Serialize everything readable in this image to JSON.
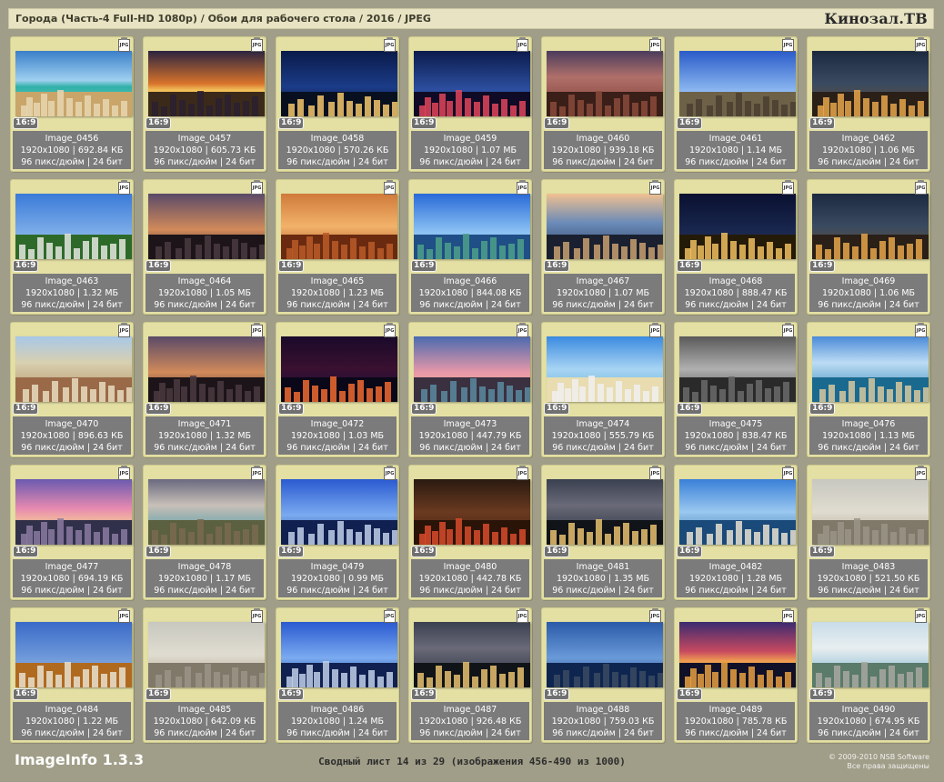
{
  "header": {
    "title": "Города (Часть-4 Full-HD 1080p) / Обои для рабочего стола / 2016 / JPEG",
    "brand": "Кинозал.ТВ"
  },
  "card_common": {
    "ratio": "16:9",
    "format_badge": "JPG",
    "dpi_line": "96 пикс/дюйм | 24 бит",
    "resolution": "1920x1080"
  },
  "cards": [
    {
      "name": "Image_0456",
      "size": "692.84 КБ",
      "theme": "resort"
    },
    {
      "name": "Image_0457",
      "size": "605.73 КБ",
      "theme": "sunset"
    },
    {
      "name": "Image_0458",
      "size": "570.26 КБ",
      "theme": "bridge-night"
    },
    {
      "name": "Image_0459",
      "size": "1.07 МБ",
      "theme": "bridge-lights"
    },
    {
      "name": "Image_0460",
      "size": "939.18 КБ",
      "theme": "cliff"
    },
    {
      "name": "Image_0461",
      "size": "1.14 МБ",
      "theme": "eiffel"
    },
    {
      "name": "Image_0462",
      "size": "1.06 МБ",
      "theme": "street-night"
    },
    {
      "name": "Image_0463",
      "size": "1.32 МБ",
      "theme": "palace"
    },
    {
      "name": "Image_0464",
      "size": "1.05 МБ",
      "theme": "dusk-city"
    },
    {
      "name": "Image_0465",
      "size": "1.23 МБ",
      "theme": "arch-bridge"
    },
    {
      "name": "Image_0466",
      "size": "844.08 КБ",
      "theme": "liberty"
    },
    {
      "name": "Image_0467",
      "size": "1.07 МБ",
      "theme": "manhattan"
    },
    {
      "name": "Image_0468",
      "size": "888.47 КБ",
      "theme": "vatican"
    },
    {
      "name": "Image_0469",
      "size": "1.06 МБ",
      "theme": "street-night"
    },
    {
      "name": "Image_0470",
      "size": "896.63 КБ",
      "theme": "aerial"
    },
    {
      "name": "Image_0471",
      "size": "1.32 МБ",
      "theme": "dusk-city"
    },
    {
      "name": "Image_0472",
      "size": "1.03 МБ",
      "theme": "night-lights"
    },
    {
      "name": "Image_0473",
      "size": "447.79 КБ",
      "theme": "pink-towers"
    },
    {
      "name": "Image_0474",
      "size": "555.79 КБ",
      "theme": "beach"
    },
    {
      "name": "Image_0475",
      "size": "838.47 КБ",
      "theme": "london-bw"
    },
    {
      "name": "Image_0476",
      "size": "1.13 МБ",
      "theme": "harbor"
    },
    {
      "name": "Image_0477",
      "size": "694.19 КБ",
      "theme": "pink-sky"
    },
    {
      "name": "Image_0478",
      "size": "1.17 МБ",
      "theme": "coast"
    },
    {
      "name": "Image_0479",
      "size": "0.99 МБ",
      "theme": "blue-city"
    },
    {
      "name": "Image_0480",
      "size": "442.78 КБ",
      "theme": "square"
    },
    {
      "name": "Image_0481",
      "size": "1.35 МБ",
      "theme": "night-skyline"
    },
    {
      "name": "Image_0482",
      "size": "1.28 МБ",
      "theme": "marina"
    },
    {
      "name": "Image_0483",
      "size": "521.50 КБ",
      "theme": "haze"
    },
    {
      "name": "Image_0484",
      "size": "1.22 МБ",
      "theme": "castle"
    },
    {
      "name": "Image_0485",
      "size": "642.09 КБ",
      "theme": "haze"
    },
    {
      "name": "Image_0486",
      "size": "1.24 МБ",
      "theme": "blue-city"
    },
    {
      "name": "Image_0487",
      "size": "926.48 КБ",
      "theme": "night-skyline"
    },
    {
      "name": "Image_0488",
      "size": "759.03 КБ",
      "theme": "island"
    },
    {
      "name": "Image_0489",
      "size": "785.78 КБ",
      "theme": "cathedral"
    },
    {
      "name": "Image_0490",
      "size": "674.95 КБ",
      "theme": "coast-city"
    }
  ],
  "footer": {
    "app_name": "ImageInfo 1.3.3",
    "summary": "Сводный лист 14 из 29 (изображения 456-490 из 1000)",
    "copyright_line1": "© 2009-2010 NSB Software",
    "copyright_line2": "Все права защищены"
  }
}
